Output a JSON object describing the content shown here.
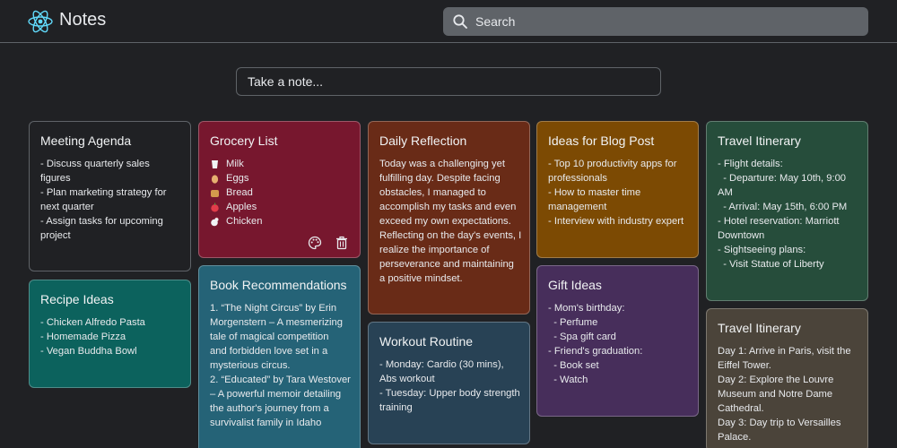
{
  "app": {
    "title": "Notes"
  },
  "search": {
    "placeholder": "Search"
  },
  "composer": {
    "placeholder": "Take a note..."
  },
  "colors": {
    "meeting": "#202124",
    "grocery": "#77172e",
    "reflection": "#692b17",
    "blog": "#7c4a03",
    "travel1": "#264d3b",
    "recipe": "#0c625d",
    "books": "#256377",
    "workout": "#284255",
    "gifts": "#472e5b",
    "travel2": "#4b443a"
  },
  "notes": {
    "meeting": {
      "title": "Meeting Agenda",
      "lines": [
        "- Discuss quarterly sales",
        "figures",
        "- Plan marketing strategy for",
        "next quarter",
        "- Assign tasks for upcoming",
        "project"
      ]
    },
    "grocery": {
      "title": "Grocery List",
      "items": [
        "Milk",
        "Eggs",
        "Bread",
        "Apples",
        "Chicken"
      ],
      "icons": [
        "milk-glass-icon",
        "egg-icon",
        "bread-icon",
        "apple-icon",
        "chicken-icon"
      ]
    },
    "reflection": {
      "title": "Daily Reflection",
      "lines": [
        "Today was a challenging yet",
        "fulfilling day. Despite facing",
        "obstacles, I managed to",
        "accomplish my tasks and even",
        "exceed my own expectations.",
        "Reflecting on the day's events, I",
        "realize the importance of",
        "perseverance and maintaining",
        "a positive mindset."
      ]
    },
    "blog": {
      "title": "Ideas for Blog Post",
      "lines": [
        "- Top 10 productivity apps for",
        "professionals",
        "- How to master time",
        "management",
        "- Interview with industry expert"
      ]
    },
    "travel1": {
      "title": "Travel Itinerary",
      "lines": [
        "- Flight details:",
        "  - Departure: May 10th, 9:00",
        "AM",
        "  - Arrival: May 15th, 6:00 PM",
        "- Hotel reservation: Marriott",
        "Downtown",
        "- Sightseeing plans:",
        "  - Visit Statue of Liberty"
      ]
    },
    "recipe": {
      "title": "Recipe Ideas",
      "lines": [
        "- Chicken Alfredo Pasta",
        "- Homemade Pizza",
        "- Vegan Buddha Bowl"
      ]
    },
    "books": {
      "title": "Book Recommendations",
      "lines": [
        "1. “The Night Circus” by Erin",
        "Morgenstern – A mesmerizing",
        "tale of magical competition",
        "and forbidden love set in a",
        "mysterious circus.",
        "2. “Educated” by Tara Westover",
        "– A powerful memoir detailing",
        "the author's journey from a",
        "survivalist family in Idaho"
      ]
    },
    "workout": {
      "title": "Workout Routine",
      "lines": [
        "- Monday: Cardio (30 mins),",
        "Abs workout",
        "- Tuesday: Upper body strength",
        "training"
      ]
    },
    "gifts": {
      "title": "Gift Ideas",
      "lines": [
        "- Mom's birthday:",
        "  - Perfume",
        "  - Spa gift card",
        "- Friend's graduation:",
        "  - Book set",
        "  - Watch"
      ]
    },
    "travel2": {
      "title": "Travel Itinerary",
      "lines": [
        "Day 1: Arrive in Paris, visit the",
        "Eiffel Tower.",
        "Day 2: Explore the Louvre",
        "Museum and Notre Dame",
        "Cathedral.",
        "Day 3: Day trip to Versailles",
        "Palace."
      ]
    }
  }
}
